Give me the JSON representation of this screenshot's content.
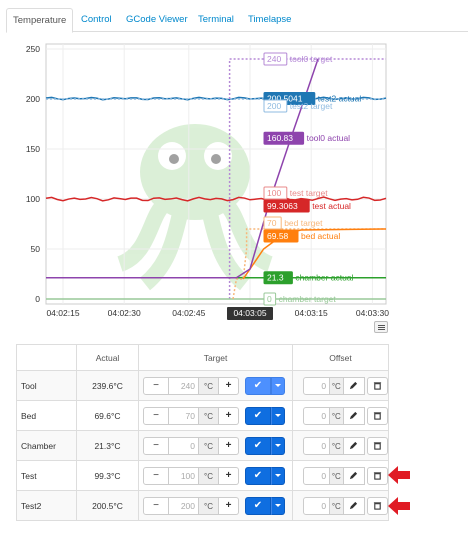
{
  "tabs": [
    {
      "label": "Temperature",
      "active": true
    },
    {
      "label": "Control"
    },
    {
      "label": "GCode Viewer"
    },
    {
      "label": "Terminal"
    },
    {
      "label": "Timelapse"
    }
  ],
  "chart_data": {
    "type": "line",
    "ylim": [
      -5,
      255
    ],
    "yticks": [
      "250",
      "200",
      "150",
      "100",
      "50",
      "0"
    ],
    "xticks": [
      "04:02:15",
      "04:02:30",
      "04:02:45",
      "04:03:05",
      "04:03:15",
      "04:03:30"
    ],
    "x_current": "04:03:05",
    "colors": {
      "tool0_actual": "#8e44ad",
      "tool0_target": "#b589d6",
      "test2_actual": "#1f77b4",
      "test2_target": "#8fbbe0",
      "test_actual": "#d62728",
      "test_target": "#e8898a",
      "bed_actual": "#ff7f0e",
      "bed_target": "#f7b67a",
      "chamber_actual": "#2ca02c",
      "chamber_target": "#98c998"
    },
    "labels": [
      {
        "key": "tool0_target",
        "value": "240",
        "name": "tool0 target",
        "y": 240
      },
      {
        "key": "test2_actual",
        "value": "200.5041",
        "name": "test2 actual",
        "y": 200.5
      },
      {
        "key": "test2_target",
        "value": "200",
        "name": "test2 target",
        "y": 193
      },
      {
        "key": "tool0_actual",
        "value": "160.83",
        "name": "tool0 actual",
        "y": 160.8
      },
      {
        "key": "test_target",
        "value": "100",
        "name": "test target",
        "y": 106
      },
      {
        "key": "test_actual",
        "value": "99.3063",
        "name": "test actual",
        "y": 93
      },
      {
        "key": "bed_target",
        "value": "70",
        "name": "bed target",
        "y": 76
      },
      {
        "key": "bed_actual",
        "value": "69.58",
        "name": "bed actual",
        "y": 63
      },
      {
        "key": "chamber_actual",
        "value": "21.3",
        "name": "chamber actual",
        "y": 21.3
      },
      {
        "key": "chamber_target",
        "value": "0",
        "name": "chamber target",
        "y": 0
      }
    ]
  },
  "table": {
    "headers": [
      "",
      "Actual",
      "Target",
      "Offset"
    ],
    "rows": [
      {
        "name": "Tool",
        "actual": "239.6°C",
        "target": "240",
        "offset": "0",
        "light": true
      },
      {
        "name": "Bed",
        "actual": "69.6°C",
        "target": "70",
        "offset": "0",
        "light": false
      },
      {
        "name": "Chamber",
        "actual": "21.3°C",
        "target": "0",
        "offset": "0",
        "light": false
      },
      {
        "name": "Test",
        "actual": "99.3°C",
        "target": "100",
        "offset": "0",
        "light": false
      },
      {
        "name": "Test2",
        "actual": "200.5°C",
        "target": "200",
        "offset": "0",
        "light": false
      }
    ],
    "unit": "°C",
    "minus": "−",
    "plus": "+",
    "check": "✔"
  }
}
